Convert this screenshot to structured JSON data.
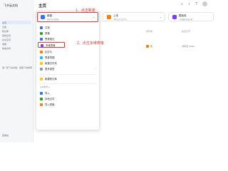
{
  "sidebar": {
    "title": "飞书云文档",
    "items": [
      "主页",
      "云盘",
      "知识库",
      "我的空间",
      "共享空间",
      "收藏",
      "快速访问"
    ],
    "bottom_note": "第一篇飞书文档，读懂飞书效率",
    "footer": "回收站"
  },
  "header": {
    "title": "主页",
    "icons": [
      "search-icon",
      "bell-icon",
      "help-icon"
    ]
  },
  "cards": [
    {
      "title": "上传",
      "subtitle": "本地文件或文件夹",
      "color": "#ff7d00",
      "icon": "cloud-upload-icon"
    },
    {
      "title": "模板库",
      "subtitle": "丰富模板轻松开始",
      "color": "#7f3bf5",
      "icon": "template-icon"
    }
  ],
  "list": {
    "headers": [
      "名称",
      "所有者",
      "最近打开"
    ],
    "row": {
      "owner": "我",
      "time": "6月6日 10:32"
    }
  },
  "dropdown": {
    "header": {
      "title": "新建",
      "subtitle": "新建文档或表格",
      "chevron": "⌄"
    },
    "items": [
      {
        "label": "文档",
        "color": "#3370ff",
        "arrow": ""
      },
      {
        "label": "表格",
        "color": "#2ea121",
        "arrow": ""
      },
      {
        "label": "思维笔记",
        "color": "#3370ff",
        "arrow": ""
      },
      {
        "label": "多维表格",
        "color": "#7f3bf5",
        "arrow": ""
      },
      {
        "label": "幻灯片",
        "color": "#ff7d00",
        "arrow": ""
      },
      {
        "label": "思维导图",
        "color": "#14c0ff",
        "arrow": ""
      },
      {
        "label": "新建文件夹",
        "color": "#ffc60a",
        "arrow": ""
      },
      {
        "label": "更多类型",
        "color": "#8f959e",
        "arrow": "›"
      },
      {
        "label": "新建知识库",
        "color": "#3370ff",
        "arrow": ""
      }
    ],
    "import_group": "从本地导入",
    "import_items": [
      {
        "label": "导入",
        "color": "#3370ff"
      },
      {
        "label": "本地文件",
        "color": "#2ea121"
      },
      {
        "label": "导入表格",
        "color": "#ff7d00"
      }
    ]
  },
  "annotations": {
    "step1": "1、点击新建",
    "step2": "2、点击多维表格"
  }
}
